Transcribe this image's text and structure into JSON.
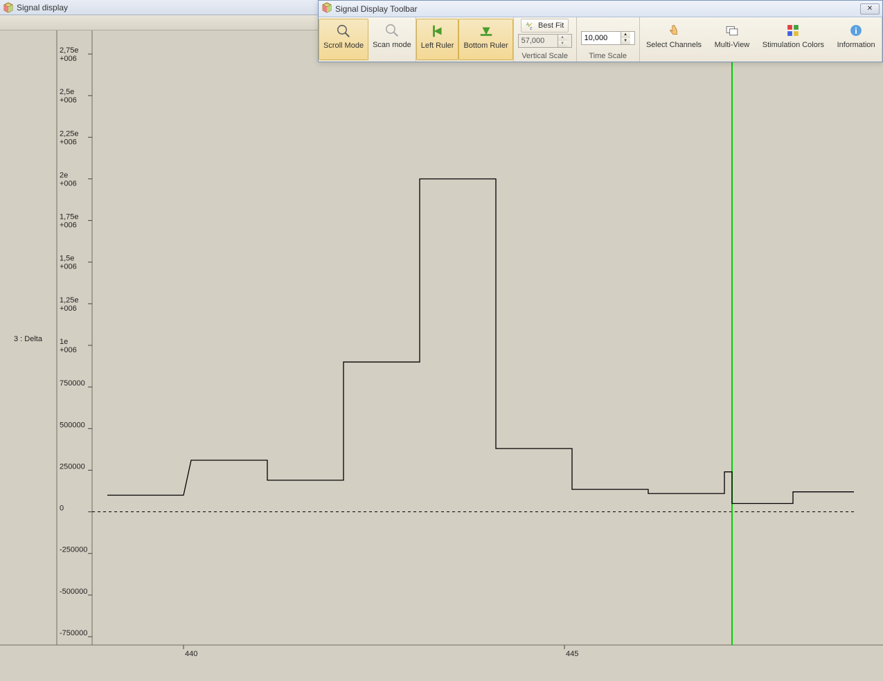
{
  "main_window": {
    "title": "Signal display"
  },
  "toolbar_window": {
    "title": "Signal Display Toolbar",
    "close_symbol": "✕",
    "buttons": {
      "scroll_mode": "Scroll Mode",
      "scan_mode": "Scan mode",
      "left_ruler": "Left Ruler",
      "bottom_ruler": "Bottom Ruler",
      "select_channels": "Select Channels",
      "multi_view": "Multi-View",
      "stimulation_colors": "Stimulation Colors",
      "information": "Information"
    },
    "vertical_scale": {
      "best_fit": "Best Fit",
      "value": "57,000",
      "caption": "Vertical Scale"
    },
    "time_scale": {
      "value": "10,000",
      "caption": "Time Scale"
    }
  },
  "chart_data": {
    "type": "line",
    "channel_label": "3 : Delta",
    "x_ticks": [
      {
        "value": 440,
        "label": "440"
      },
      {
        "value": 445,
        "label": "445"
      }
    ],
    "y_ticks": [
      {
        "value": -750000,
        "label": "-750000"
      },
      {
        "value": -500000,
        "label": "-500000"
      },
      {
        "value": -250000,
        "label": "-250000"
      },
      {
        "value": 0,
        "label": "0"
      },
      {
        "value": 250000,
        "label": "250000"
      },
      {
        "value": 500000,
        "label": "500000"
      },
      {
        "value": 750000,
        "label": "750000"
      },
      {
        "value": 1000000,
        "label": "1e\n+006"
      },
      {
        "value": 1250000,
        "label": "1,25e\n+006"
      },
      {
        "value": 1500000,
        "label": "1,5e\n+006"
      },
      {
        "value": 1750000,
        "label": "1,75e\n+006"
      },
      {
        "value": 2000000,
        "label": "2e\n+006"
      },
      {
        "value": 2250000,
        "label": "2,25e\n+006"
      },
      {
        "value": 2500000,
        "label": "2,5e\n+006"
      },
      {
        "value": 2750000,
        "label": "2,75e\n+006"
      }
    ],
    "xlim": [
      438.8,
      448.8
    ],
    "ylim": [
      -800000,
      2850000
    ],
    "zero_line": 0,
    "cursor_x": 447.2,
    "series": [
      {
        "name": "Delta",
        "step": true,
        "points": [
          {
            "x": 439.0,
            "y": 100000
          },
          {
            "x": 440.0,
            "y": 100000
          },
          {
            "x": 440.1,
            "y": 310000
          },
          {
            "x": 441.1,
            "y": 310000
          },
          {
            "x": 441.1,
            "y": 190000
          },
          {
            "x": 442.1,
            "y": 190000
          },
          {
            "x": 442.1,
            "y": 900000
          },
          {
            "x": 443.1,
            "y": 900000
          },
          {
            "x": 443.1,
            "y": 2000000
          },
          {
            "x": 444.1,
            "y": 2000000
          },
          {
            "x": 444.1,
            "y": 380000
          },
          {
            "x": 445.1,
            "y": 380000
          },
          {
            "x": 445.1,
            "y": 135000
          },
          {
            "x": 446.1,
            "y": 135000
          },
          {
            "x": 446.1,
            "y": 110000
          },
          {
            "x": 447.1,
            "y": 110000
          },
          {
            "x": 447.1,
            "y": 240000
          },
          {
            "x": 447.2,
            "y": 240000
          },
          {
            "x": 447.2,
            "y": 50000
          },
          {
            "x": 448.0,
            "y": 50000
          },
          {
            "x": 448.0,
            "y": 120000
          },
          {
            "x": 448.8,
            "y": 120000
          }
        ]
      }
    ]
  }
}
